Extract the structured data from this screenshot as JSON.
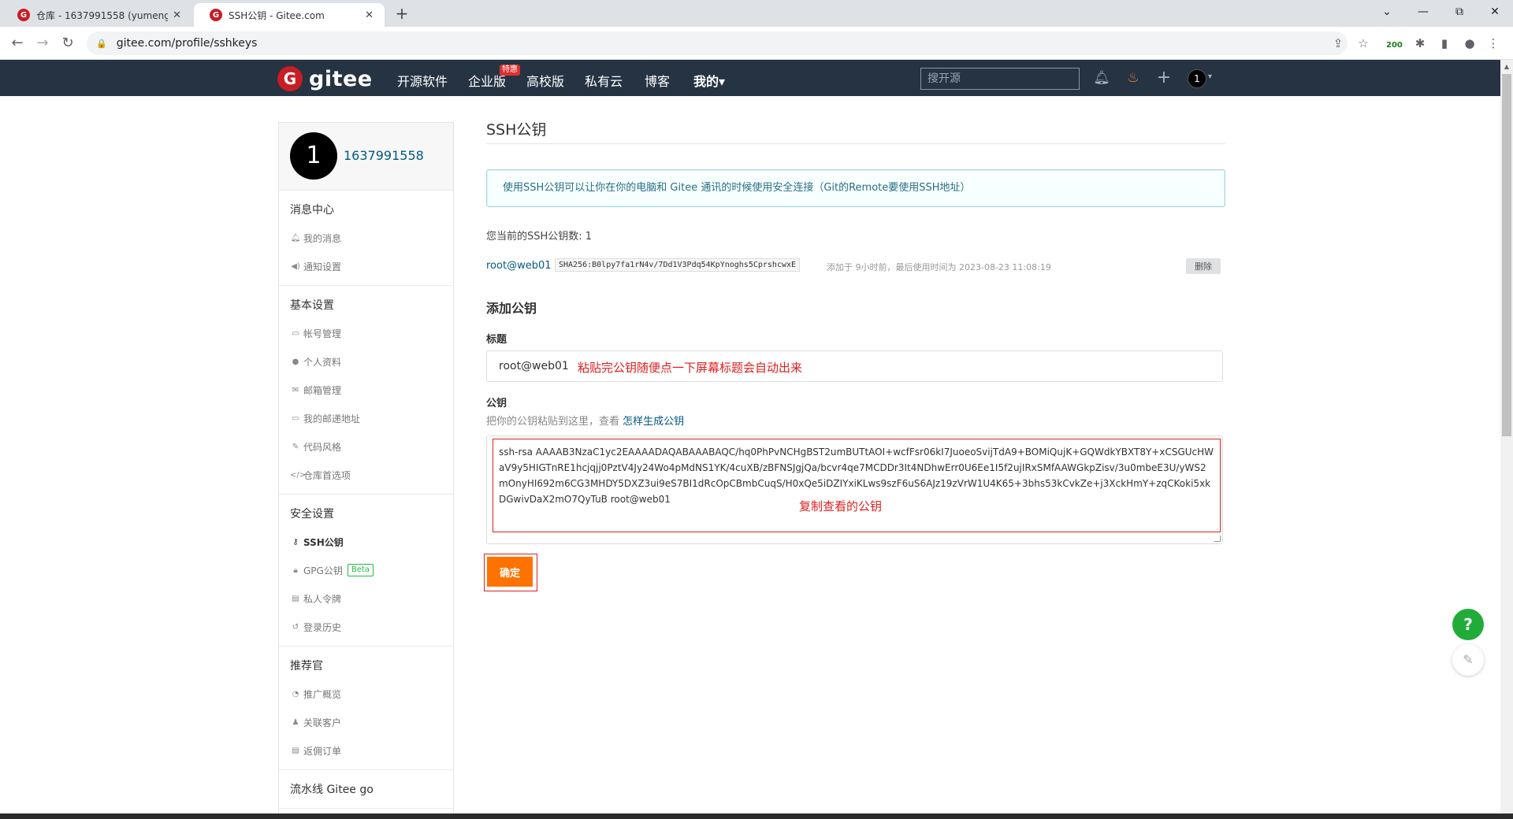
{
  "browser": {
    "tabs": [
      {
        "title": "仓库 - 1637991558 (yumengw",
        "favicon": "G"
      },
      {
        "title": "SSH公钥 - Gitee.com",
        "favicon": "G"
      }
    ],
    "url": "gitee.com/profile/sshkeys",
    "extension_badge": "200",
    "window_controls": [
      "⌄",
      "—",
      "⧉",
      "✕"
    ]
  },
  "header": {
    "logo_mark": "G",
    "logo_text": "gitee",
    "nav": [
      "开源软件",
      "企业版",
      "高校版",
      "私有云",
      "博客",
      "我的▾"
    ],
    "hot_badge": "特惠",
    "search_placeholder": "搜开源",
    "avatar": "1"
  },
  "sidebar": {
    "avatar": "1",
    "username": "1637991558",
    "groups": [
      {
        "title": "消息中心",
        "items": [
          {
            "label": "我的消息",
            "icon": "bell-icon"
          },
          {
            "label": "通知设置",
            "icon": "speaker-icon"
          }
        ]
      },
      {
        "title": "基本设置",
        "items": [
          {
            "label": "帐号管理",
            "icon": "id-card-icon"
          },
          {
            "label": "个人资料",
            "icon": "user-icon"
          },
          {
            "label": "邮箱管理",
            "icon": "mail-icon"
          },
          {
            "label": "我的邮递地址",
            "icon": "address-card-icon"
          },
          {
            "label": "代码风格",
            "icon": "paintbrush-icon"
          },
          {
            "label": "仓库首选项",
            "icon": "code-icon"
          }
        ]
      },
      {
        "title": "安全设置",
        "items": [
          {
            "label": "SSH公钥",
            "icon": "key-icon",
            "active": true
          },
          {
            "label": "GPG公钥",
            "icon": "lock-icon",
            "badge": "Beta"
          },
          {
            "label": "私人令牌",
            "icon": "token-icon"
          },
          {
            "label": "登录历史",
            "icon": "history-icon"
          }
        ]
      },
      {
        "title": "推荐官",
        "items": [
          {
            "label": "推广概览",
            "icon": "chart-icon"
          },
          {
            "label": "关联客户",
            "icon": "user-link-icon"
          },
          {
            "label": "返佣订单",
            "icon": "order-icon"
          }
        ]
      },
      {
        "title": "流水线 Gitee go",
        "items": []
      }
    ]
  },
  "main": {
    "title": "SSH公钥",
    "info": "使用SSH公钥可以让你在你的电脑和 Gitee 通讯的时候使用安全连接（Git的Remote要使用SSH地址）",
    "key_count": "您当前的SSH公钥数: 1",
    "existing_key": {
      "name": "root@web01",
      "fingerprint": "SHA256:B0lpy7fa1rN4v/7Dd1V3Pdq54KpYnoghs5CprshcwxE",
      "meta": "添加于 9小时前，最后使用时间为 2023-08-23 11:08:19",
      "delete_label": "删除"
    },
    "add_section_title": "添加公钥",
    "title_label": "标题",
    "title_value": "root@web01",
    "title_annotation": "粘贴完公钥随便点一下屏幕标题会自动出来",
    "key_label": "公钥",
    "key_hint": "把你的公钥粘贴到这里，查看 ",
    "key_hint_link": "怎样生成公钥",
    "key_value": "ssh-rsa AAAAB3NzaC1yc2EAAAADAQABAAABAQC/hq0PhPvNCHgBST2umBUTtAOI+wcfFsr06kI7JuoeoSvijTdA9+BOMiQujK+GQWdkYBXT8Y+xCSGUcHWaV9y5HIGTnRE1hcjqjj0PztV4Jy24Wo4pMdNS1YK/4cuXB/zBFNSJgjQa/bcvr4qe7MCDDr3It4NDhwErr0U6Ee1I5f2ujIRxSMfAAWGkpZisv/3u0mbeE3U/yWS2mOnyHI692m6CG3MHDY5DXZ3ui9eS7BI1dRcOpCBmbCuqS/H0xQe5iDZIYxiKLws9szF6uS6AJz19zVrW1U4K65+3bhs53kCvkZe+j3XckHmY+zqCKoki5xkDGwivDaX2mO7QyTuB root@web01",
    "key_annotation": "复制查看的公钥",
    "submit_label": "确定"
  },
  "floating": {
    "help": "?",
    "edit": "✎"
  },
  "colors": {
    "brand_red": "#c71d23",
    "header_bg": "#263343",
    "submit_orange": "#fe7300",
    "annotation_red": "#e02020",
    "help_green": "#21ac3a"
  }
}
